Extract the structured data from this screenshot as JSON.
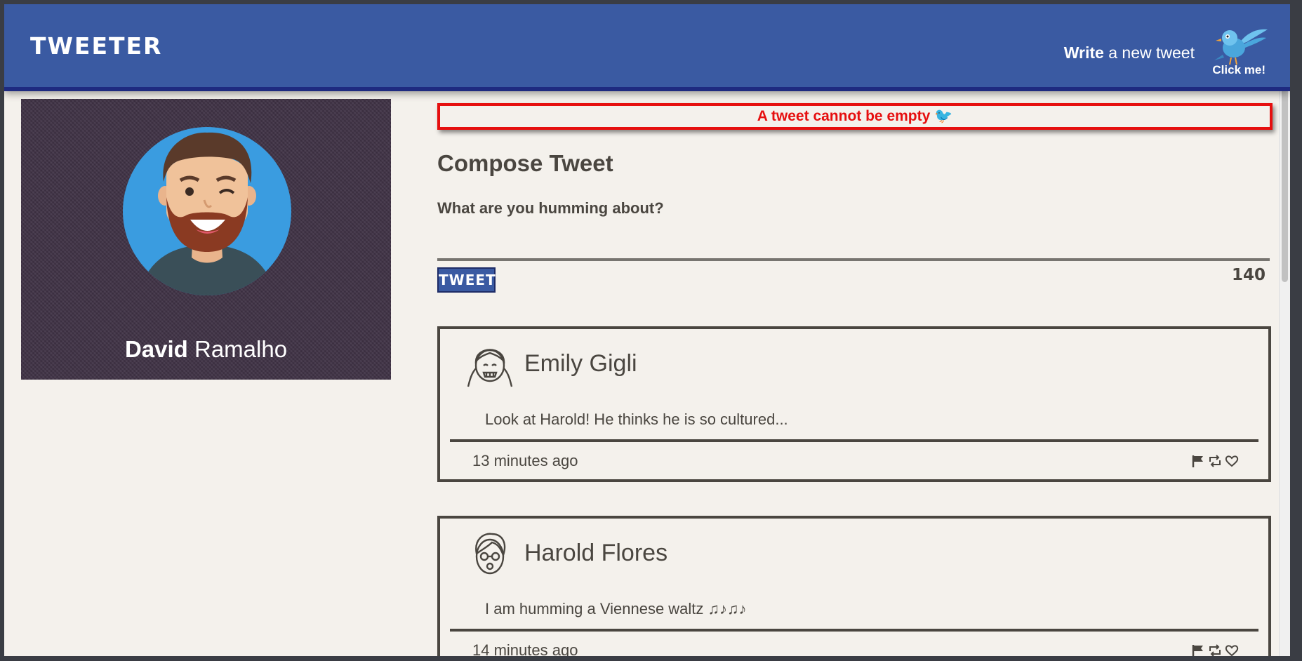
{
  "nav": {
    "brand": "TWEETER",
    "write_bold": "Write",
    "write_rest": " a new tweet",
    "click_label": "Click me!",
    "bird_icon": "bird-icon"
  },
  "profile": {
    "first_name": "David",
    "last_name": "Ramalho"
  },
  "error": {
    "message": "A tweet cannot be empty 🐦"
  },
  "compose": {
    "title": "Compose Tweet",
    "placeholder": "What are you humming about?",
    "button_label": "TWEET",
    "counter": "140"
  },
  "tweets": [
    {
      "name": "Emily Gigli",
      "text": "Look at Harold! He thinks he is so cultured...",
      "time": "13 minutes ago"
    },
    {
      "name": "Harold Flores",
      "text": "I am humming a Viennese waltz ♫♪♫♪",
      "time": "14 minutes ago"
    }
  ],
  "colors": {
    "nav_bg": "#3a5aa2",
    "page_bg": "#f4f1ec",
    "error": "#e60f0f",
    "text": "#4a4640"
  }
}
